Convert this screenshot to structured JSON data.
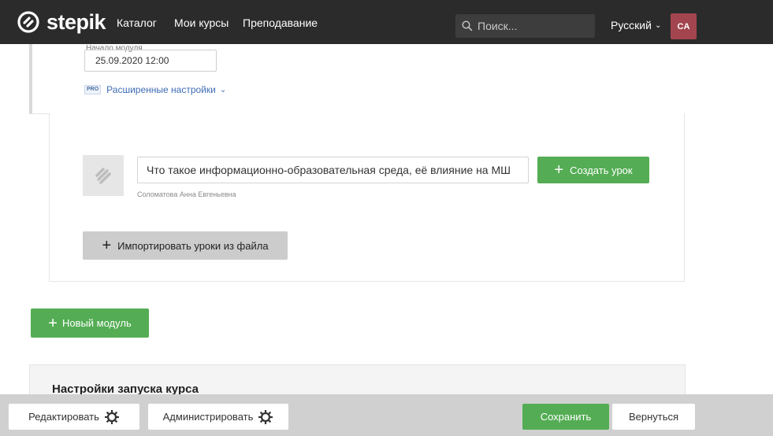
{
  "navbar": {
    "logo_text": "stepik",
    "links": [
      "Каталог",
      "Мои курсы",
      "Преподавание"
    ],
    "search_placeholder": "Поиск...",
    "language": "Русский",
    "avatar_initials": "CA"
  },
  "module": {
    "start_label": "Начало модуля",
    "start_value": "25.09.2020 12:00",
    "pro_badge": "PRO",
    "advanced_settings": "Расширенные настройки"
  },
  "lesson": {
    "title_value": "Что такое информационно-образовательная среда, её влияние на МШ",
    "author": "Соломатова Анна Евгеньевна",
    "create_button": "Создать урок",
    "import_button": "Импортировать уроки из файла"
  },
  "new_module_button": "Новый модуль",
  "launch_settings": {
    "title": "Настройки запуска курса"
  },
  "toolbar": {
    "edit_button": "Редактировать",
    "admin_button": "Администрировать",
    "save_button": "Сохранить",
    "back_button": "Вернуться"
  },
  "colors": {
    "navbar_bg": "#2b2b2b",
    "accent_green": "#54ad54",
    "link_blue": "#3d6bb3",
    "avatar_bg": "#a3454e"
  }
}
